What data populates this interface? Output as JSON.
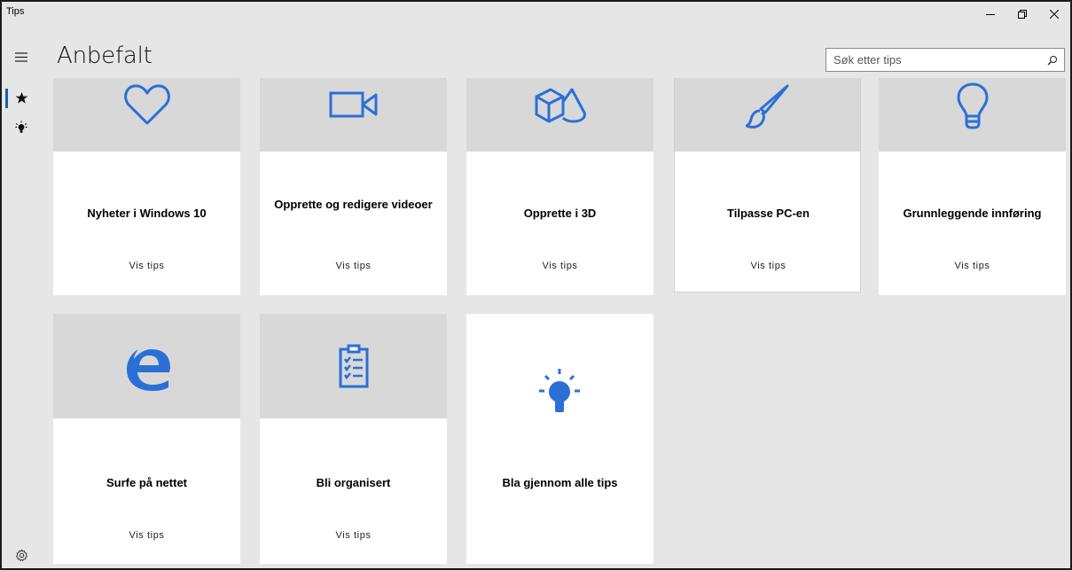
{
  "window": {
    "title": "Tips"
  },
  "page": {
    "heading": "Anbefalt"
  },
  "search": {
    "placeholder": "Søk etter tips"
  },
  "nav": {
    "items": [
      {
        "name": "menu",
        "icon": "hamburger-icon"
      },
      {
        "name": "recommended",
        "icon": "star-icon",
        "active": true
      },
      {
        "name": "tips",
        "icon": "lightbulb-icon"
      },
      {
        "name": "settings",
        "icon": "gear-icon"
      }
    ]
  },
  "accent_color": "#2b6fd6",
  "cards": [
    {
      "title": "Nyheter i Windows 10",
      "action": "Vis tips",
      "icon": "heart-icon"
    },
    {
      "title": "Opprette og redigere videoer",
      "action": "Vis tips",
      "icon": "video-camera-icon"
    },
    {
      "title": "Opprette i 3D",
      "action": "Vis tips",
      "icon": "3d-shapes-icon"
    },
    {
      "title": "Tilpasse PC-en",
      "action": "Vis tips",
      "icon": "paintbrush-icon"
    },
    {
      "title": "Grunnleggende innføring",
      "action": "Vis tips",
      "icon": "lightbulb-outline-icon"
    },
    {
      "title": "Surfe på nettet",
      "action": "Vis tips",
      "icon": "edge-browser-icon"
    },
    {
      "title": "Bli organisert",
      "action": "Vis tips",
      "icon": "clipboard-checklist-icon"
    },
    {
      "title": "Bla gjennom alle tips",
      "icon": "lightbulb-glow-icon"
    }
  ]
}
